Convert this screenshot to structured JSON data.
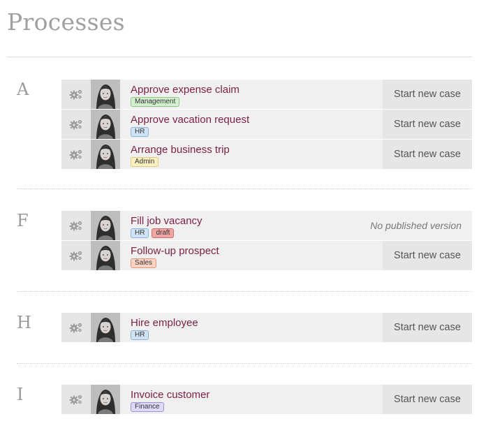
{
  "page": {
    "title": "Processes"
  },
  "colors": {
    "process_link": "#7a1f45",
    "row_bg": "#f0f0f0",
    "button_bg": "#e6e6e6"
  },
  "tag_styles": {
    "Management": {
      "bg": "#d3efcf",
      "border": "#8fc585"
    },
    "HR": {
      "bg": "#cfe3f5",
      "border": "#8ab4d9"
    },
    "Admin": {
      "bg": "#faf0c2",
      "border": "#e0cc7a"
    },
    "draft": {
      "bg": "#f1a6a6",
      "border": "#d06b6b"
    },
    "Sales": {
      "bg": "#fad3c2",
      "border": "#e0987a"
    },
    "Finance": {
      "bg": "#ddd9f7",
      "border": "#9c92d8"
    }
  },
  "groups": [
    {
      "letter": "A",
      "processes": [
        {
          "name": "Approve expense claim",
          "tags": [
            "Management"
          ],
          "action": "Start new case",
          "action_type": "button"
        },
        {
          "name": "Approve vacation request",
          "tags": [
            "HR"
          ],
          "action": "Start new case",
          "action_type": "button"
        },
        {
          "name": "Arrange business trip",
          "tags": [
            "Admin"
          ],
          "action": "Start new case",
          "action_type": "button"
        }
      ]
    },
    {
      "letter": "F",
      "processes": [
        {
          "name": "Fill job vacancy",
          "tags": [
            "HR",
            "draft"
          ],
          "action": "No published version",
          "action_type": "text"
        },
        {
          "name": "Follow-up prospect",
          "tags": [
            "Sales"
          ],
          "action": "Start new case",
          "action_type": "button"
        }
      ]
    },
    {
      "letter": "H",
      "processes": [
        {
          "name": "Hire employee",
          "tags": [
            "HR"
          ],
          "action": "Start new case",
          "action_type": "button"
        }
      ]
    },
    {
      "letter": "I",
      "processes": [
        {
          "name": "Invoice customer",
          "tags": [
            "Finance"
          ],
          "action": "Start new case",
          "action_type": "button"
        }
      ]
    }
  ]
}
